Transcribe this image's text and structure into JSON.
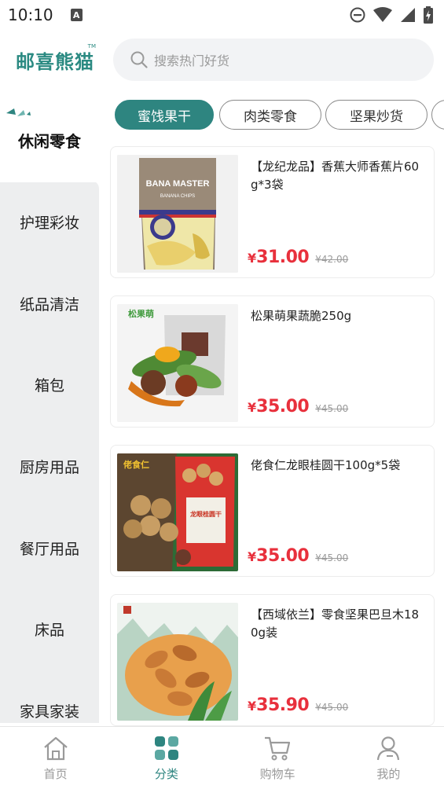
{
  "status_bar": {
    "time": "10:10",
    "notice_glyph": "A"
  },
  "header": {
    "logo_text": "邮喜熊猫",
    "logo_tm": "TM"
  },
  "search": {
    "placeholder": "搜索热门好货"
  },
  "sidebar": {
    "items": [
      {
        "label": "休闲零食",
        "active": true
      },
      {
        "label": "护理彩妆"
      },
      {
        "label": "纸品清洁"
      },
      {
        "label": "箱包"
      },
      {
        "label": "厨房用品"
      },
      {
        "label": "餐厅用品"
      },
      {
        "label": "床品"
      },
      {
        "label": "家具家装"
      }
    ]
  },
  "tabs": [
    {
      "label": "蜜饯果干",
      "active": true
    },
    {
      "label": "肉类零食"
    },
    {
      "label": "坚果炒货"
    }
  ],
  "products": [
    {
      "name": "【龙纪龙品】香蕉大师香蕉片60g*3袋",
      "currency": "¥",
      "price": "31.00",
      "original": "¥42.00",
      "thumb_text": "BANA MASTER",
      "thumb_sub": "BANANA CHIPS"
    },
    {
      "name": "松果萌果蔬脆250g",
      "currency": "¥",
      "price": "35.00",
      "original": "¥45.00",
      "thumb_text": "松果萌"
    },
    {
      "name": "佬食仁龙眼桂圆干100g*5袋",
      "currency": "¥",
      "price": "35.00",
      "original": "¥45.00",
      "thumb_text": "佬食仁",
      "thumb_sub": "龙眼桂圆干"
    },
    {
      "name": "【西域依兰】零食坚果巴旦木180g装",
      "currency": "¥",
      "price": "35.90",
      "original": "¥45.00"
    }
  ],
  "bottom_nav": [
    {
      "label": "首页",
      "icon": "home-icon"
    },
    {
      "label": "分类",
      "icon": "category-grid-icon",
      "active": true
    },
    {
      "label": "购物车",
      "icon": "cart-icon"
    },
    {
      "label": "我的",
      "icon": "profile-icon"
    }
  ],
  "colors": {
    "brand": "#2e8580",
    "price": "#e8303c",
    "sidebar_bg": "#edeeef"
  }
}
